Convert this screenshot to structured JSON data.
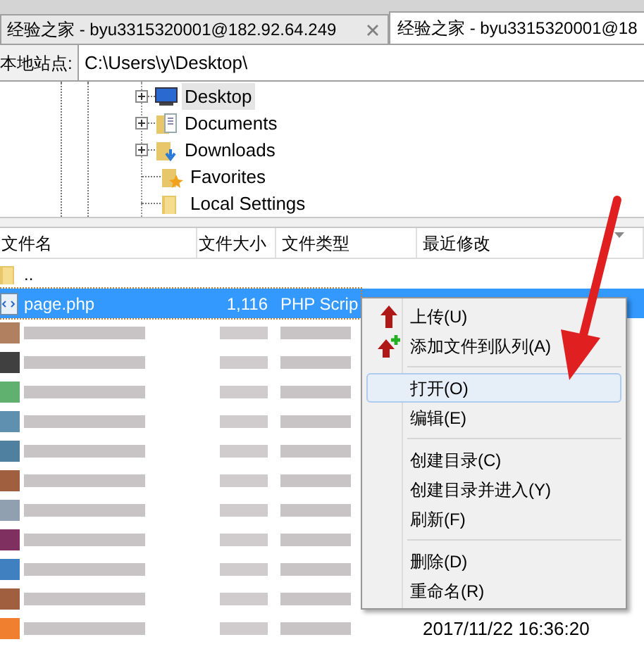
{
  "tabs": [
    {
      "label": "经验之家 - byu3315320001@182.92.64.249",
      "selected": false
    },
    {
      "label": "经验之家 - byu3315320001@18",
      "selected": true
    }
  ],
  "address": {
    "label": "本地站点:",
    "value": "C:\\Users\\y\\Desktop\\"
  },
  "tree": [
    {
      "label": "Desktop",
      "kind": "desktop",
      "expandable": true,
      "selected": true
    },
    {
      "label": "Documents",
      "kind": "documents",
      "expandable": true,
      "selected": false
    },
    {
      "label": "Downloads",
      "kind": "downloads",
      "expandable": true,
      "selected": false
    },
    {
      "label": "Favorites",
      "kind": "favorites",
      "expandable": false,
      "selected": false
    },
    {
      "label": "Local Settings",
      "kind": "folder",
      "expandable": false,
      "selected": false
    }
  ],
  "file_list": {
    "columns": [
      "文件名",
      "文件大小",
      "文件类型",
      "最近修改"
    ],
    "rows": [
      {
        "kind": "folder",
        "name": "..",
        "selected": false
      },
      {
        "kind": "file",
        "name": "page.php",
        "size": "1,116",
        "type": "PHP Scrip",
        "selected": true
      },
      {
        "kind": "redacted",
        "selected": false
      },
      {
        "kind": "redacted",
        "selected": false
      },
      {
        "kind": "redacted",
        "selected": false
      },
      {
        "kind": "redacted",
        "selected": false
      },
      {
        "kind": "redacted",
        "selected": false
      },
      {
        "kind": "redacted",
        "selected": false
      },
      {
        "kind": "redacted",
        "selected": false
      },
      {
        "kind": "redacted",
        "selected": false
      },
      {
        "kind": "redacted",
        "selected": false
      },
      {
        "kind": "redacted",
        "selected": false
      },
      {
        "kind": "redacted",
        "modified": "2017/11/22 16:36:20",
        "selected": false
      }
    ]
  },
  "context_menu": [
    {
      "kind": "upload",
      "label": "上传(U)",
      "highlighted": false
    },
    {
      "kind": "add-queue",
      "label": "添加文件到队列(A)",
      "highlighted": false
    },
    {
      "kind": "separator"
    },
    {
      "kind": "item",
      "label": "打开(O)",
      "highlighted": true
    },
    {
      "kind": "item",
      "label": "编辑(E)",
      "highlighted": false
    },
    {
      "kind": "separator"
    },
    {
      "kind": "item",
      "label": "创建目录(C)",
      "highlighted": false
    },
    {
      "kind": "item",
      "label": "创建目录并进入(Y)",
      "highlighted": false
    },
    {
      "kind": "item",
      "label": "刷新(F)",
      "highlighted": false
    },
    {
      "kind": "separator"
    },
    {
      "kind": "item",
      "label": "删除(D)",
      "highlighted": false
    },
    {
      "kind": "item",
      "label": "重命名(R)",
      "highlighted": false
    }
  ]
}
